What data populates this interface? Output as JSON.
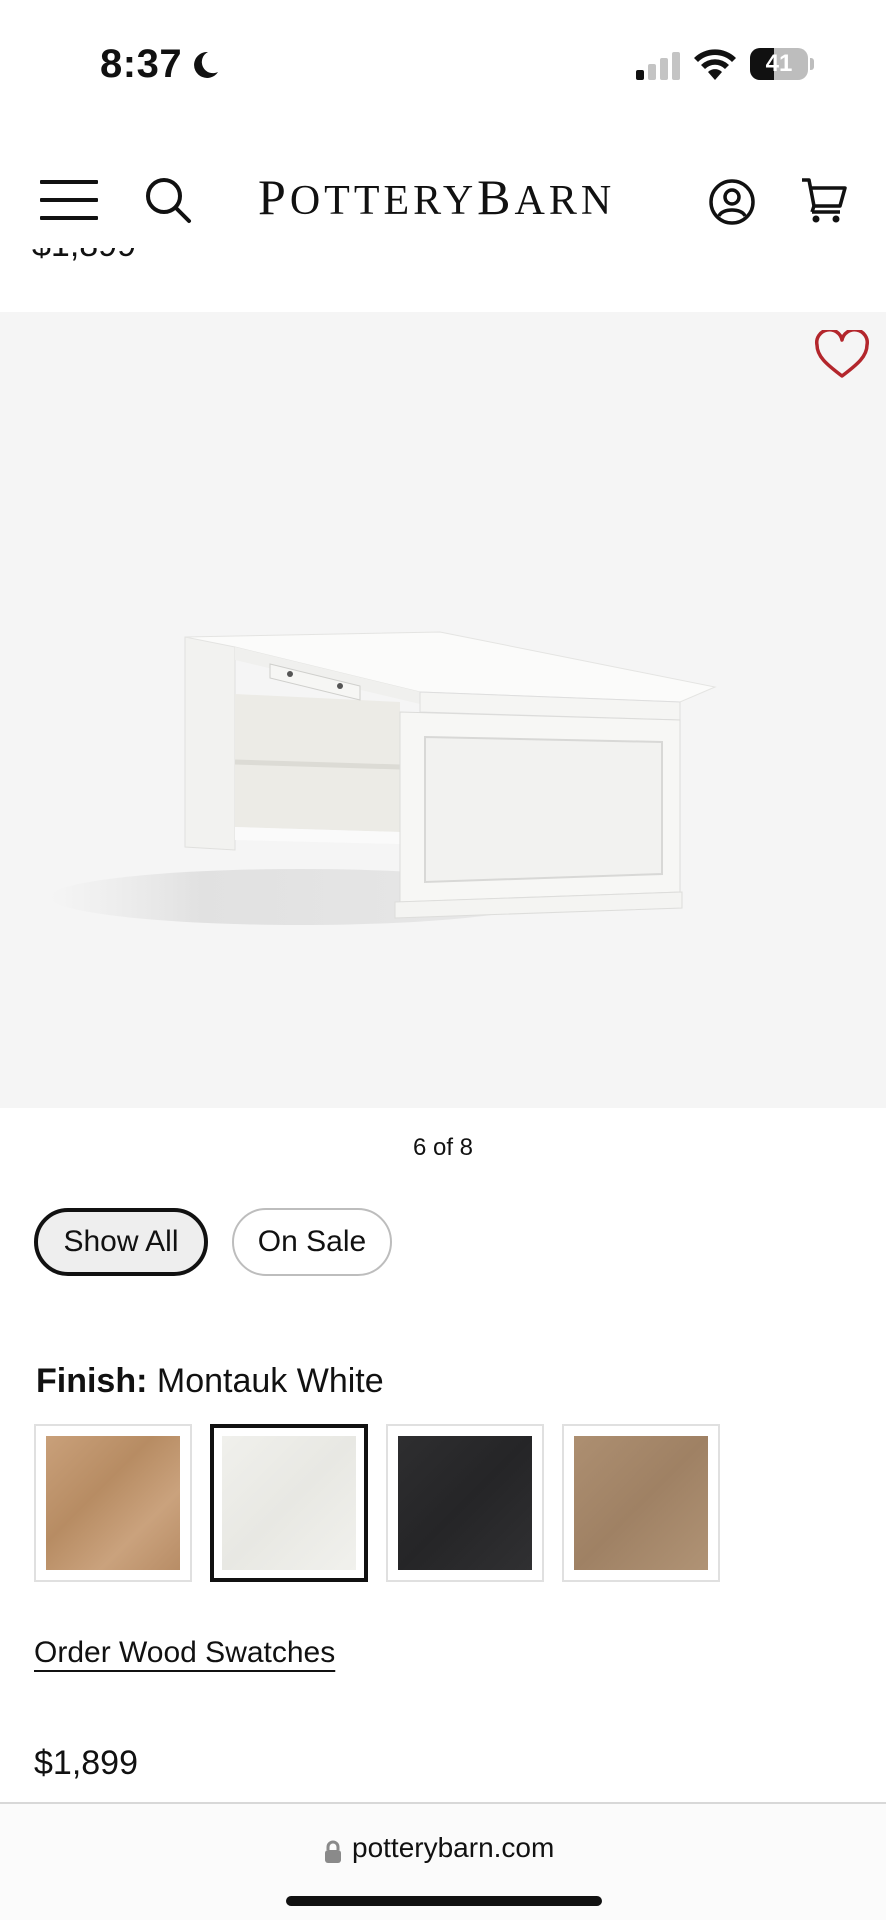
{
  "status_bar": {
    "time": "8:37",
    "battery_level": "41"
  },
  "header": {
    "brand": "POTTERYBARN",
    "icons": [
      "menu-icon",
      "search-icon",
      "account-icon",
      "cart-icon"
    ]
  },
  "product": {
    "partial_price_top": "$1,899",
    "image_counter": "6 of 8",
    "favorite_icon": "heart-icon",
    "favorite_color": "#b3262c"
  },
  "filters": {
    "show_all": "Show All",
    "on_sale": "On Sale",
    "selected": "Show All"
  },
  "finish": {
    "label": "Finish:",
    "value": "Montauk White",
    "swatches": [
      {
        "name": "oak",
        "color": "#c49a72",
        "selected": false
      },
      {
        "name": "montauk-white",
        "color": "#eeeeea",
        "selected": true
      },
      {
        "name": "black",
        "color": "#2a2a2b",
        "selected": false
      },
      {
        "name": "seadrift",
        "color": "#a98b6d",
        "selected": false
      }
    ]
  },
  "order_swatches_link": "Order Wood Swatches",
  "price": "$1,899",
  "browser": {
    "url": "potterybarn.com"
  }
}
